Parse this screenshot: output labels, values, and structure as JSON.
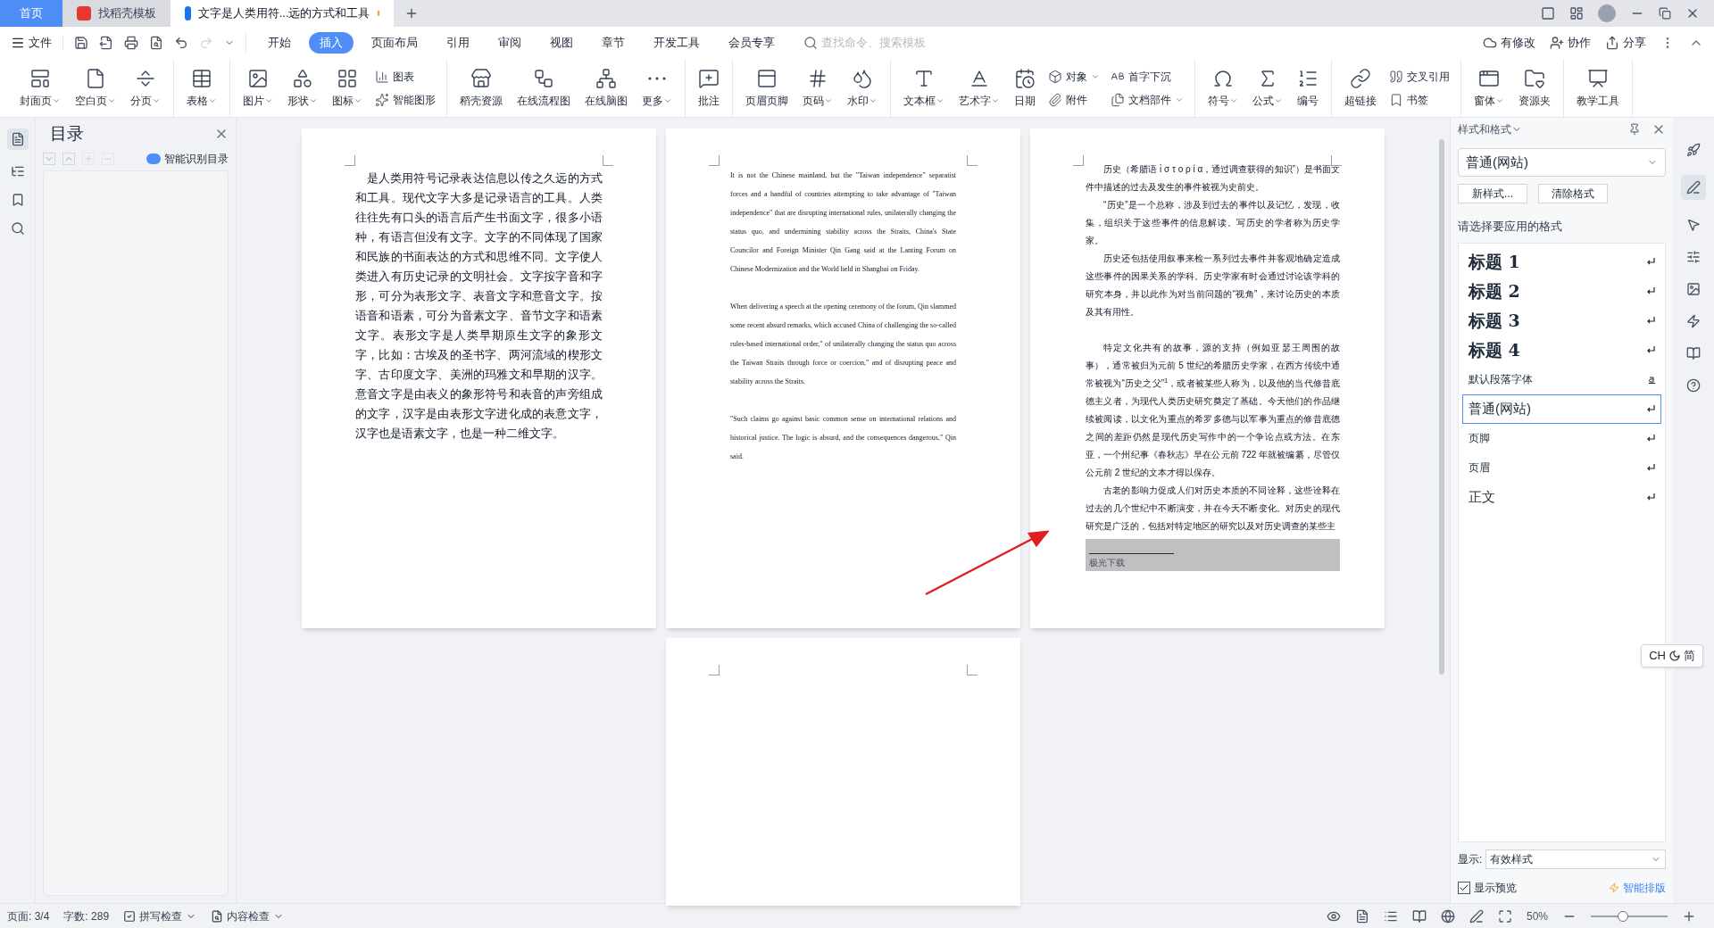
{
  "tabs": [
    {
      "label": "首页",
      "kind": "home",
      "selected": false
    },
    {
      "label": "找稻壳模板",
      "kind": "template",
      "selected": false
    },
    {
      "label": "文字是人类用符...远的方式和工具",
      "kind": "doc",
      "selected": true,
      "modified": true
    }
  ],
  "menu": {
    "file": "文件",
    "tabs": [
      {
        "label": "开始",
        "selected": false
      },
      {
        "label": "插入",
        "selected": true
      },
      {
        "label": "页面布局",
        "selected": false
      },
      {
        "label": "引用",
        "selected": false
      },
      {
        "label": "审阅",
        "selected": false
      },
      {
        "label": "视图",
        "selected": false
      },
      {
        "label": "章节",
        "selected": false
      },
      {
        "label": "开发工具",
        "selected": false
      },
      {
        "label": "会员专享",
        "selected": false
      }
    ],
    "search_placeholder": "查找命令、搜索模板",
    "actions": [
      "有修改",
      "协作",
      "分享"
    ]
  },
  "ribbon": [
    {
      "items": [
        {
          "kind": "large",
          "label": "封面页",
          "caret": true
        },
        {
          "kind": "large",
          "label": "空白页",
          "caret": true
        },
        {
          "kind": "large",
          "label": "分页",
          "caret": true
        }
      ]
    },
    {
      "items": [
        {
          "kind": "large",
          "label": "表格",
          "caret": true
        }
      ]
    },
    {
      "items": [
        {
          "kind": "large",
          "label": "图片",
          "caret": true
        },
        {
          "kind": "large",
          "label": "形状",
          "caret": true
        },
        {
          "kind": "large",
          "label": "图标",
          "caret": true
        },
        {
          "kind": "stack",
          "items": [
            {
              "label": "图表",
              "caret": false
            },
            {
              "label": "智能图形",
              "caret": false
            }
          ]
        }
      ]
    },
    {
      "items": [
        {
          "kind": "large",
          "label": "稻壳资源",
          "caret": false
        },
        {
          "kind": "large",
          "label": "在线流程图",
          "caret": false
        },
        {
          "kind": "large",
          "label": "在线脑图",
          "caret": false
        },
        {
          "kind": "large",
          "label": "更多",
          "caret": true
        }
      ]
    },
    {
      "items": [
        {
          "kind": "large",
          "label": "批注",
          "caret": false
        }
      ]
    },
    {
      "items": [
        {
          "kind": "large",
          "label": "页眉页脚",
          "caret": false
        },
        {
          "kind": "large",
          "label": "页码",
          "caret": true
        },
        {
          "kind": "large",
          "label": "水印",
          "caret": true
        }
      ]
    },
    {
      "items": [
        {
          "kind": "large",
          "label": "文本框",
          "caret": true
        },
        {
          "kind": "large",
          "label": "艺术字",
          "caret": true
        },
        {
          "kind": "large",
          "label": "日期",
          "caret": false
        },
        {
          "kind": "stack",
          "items": [
            {
              "label": "对象",
              "caret": true
            },
            {
              "label": "附件",
              "caret": false
            }
          ]
        },
        {
          "kind": "stack",
          "items": [
            {
              "label": "首字下沉",
              "caret": false
            },
            {
              "label": "文档部件",
              "caret": true
            }
          ]
        }
      ]
    },
    {
      "items": [
        {
          "kind": "large",
          "label": "符号",
          "caret": true
        },
        {
          "kind": "large",
          "label": "公式",
          "caret": true
        },
        {
          "kind": "large",
          "label": "编号",
          "caret": false
        }
      ]
    },
    {
      "items": [
        {
          "kind": "large",
          "label": "超链接",
          "caret": false
        },
        {
          "kind": "stack",
          "items": [
            {
              "label": "交叉引用",
              "caret": false
            },
            {
              "label": "书签",
              "caret": false
            }
          ]
        }
      ]
    },
    {
      "items": [
        {
          "kind": "large",
          "label": "窗体",
          "caret": true
        },
        {
          "kind": "large",
          "label": "资源夹",
          "caret": false
        }
      ]
    },
    {
      "items": [
        {
          "kind": "large",
          "label": "教学工具",
          "caret": false
        }
      ]
    }
  ],
  "nav": {
    "title": "目录",
    "smart": "智能识别目录"
  },
  "pages": [
    {
      "kind": "cn",
      "paragraphs": [
        "是人类用符号记录表达信息以传之久远的方式和工具。现代文字大多是记录语言的工具。人类往往先有口头的语言后产生书面文字，很多小语种，有语言但没有文字。文字的不同体现了国家和民族的书面表达的方式和思维不同。文字使人类进入有历史记录的文明社会。文字按字音和字形，可分为表形文字、表音文字和意音文字。按语音和语素，可分为音素文字、音节文字和语素文字。表形文字是人类早期原生文字的象形文字，比如：古埃及的圣书字、两河流域的楔形文字、古印度文字、美洲的玛雅文和早期的汉字。意音文字是由表义的象形符号和表音的声旁组成的文字，汉字是由表形文字进化成的表意文字，汉字也是语素文字，也是一种二维文字。"
      ]
    },
    {
      "kind": "en",
      "paragraphs": [
        "It is not the Chinese mainland, but the \"Taiwan independence\" separatist forces and a handful of countries attempting to take advantage of \"Taiwan independence\" that are disrupting international rules, unilaterally changing the status quo, and undermining stability across the Straits, China's State Councilor and Foreign Minister Qin Gang said at the Lanting Forum on Chinese Modernization and the World held in Shanghai on Friday.",
        "When delivering a speech at the opening ceremony of the forum, Qin slammed some recent absurd remarks, which accused China of challenging the so-called rules-based international order,\" of unilaterally changing the status quo across the Taiwan Straits through force or coercion,\" and of disrupting peace and stability across the Straits.",
        "\"Such claims go against basic common sense on international relations and historical justice. The logic is absurd, and the consequences dangerous,\" Qin said."
      ]
    },
    {
      "kind": "small",
      "paragraphs": [
        "历史（希腊语 ἱ σ τ ο ρ ί α，通过调查获得的知识”）是书面文件中描述的过去及发生的事件被视为史前史。",
        "“历史”是一个总称，涉及到过去的事件以及记忆，发现，收集，组织关于这些事件的信息解读。写历史的学者称为历史学家。",
        "历史还包括使用叙事来检一系列过去事件并客观地确定造成这些事件的因果关系的学科。历史学家有时会通过讨论该学科的研究本身，并以此作为对当前问题的“视角”，来讨论历史的本质及其有用性。",
        "特定文化共有的故事，源的支持（例如亚瑟王周围的故事），通常被归为元前 5 世纪的希腊历史学家，在西方传统中通常被视为“历史之父”$^{1}$，或者被某些人称为，以及他的当代修昔底德主义者，为现代人类历史研究奠定了基础。今天他们的作品继续被阅读，以文化为重点的希罗多德与以军事为重点的修昔底德之间的差距仍然是现代历史写作中的一个争论点或方法。在东亚，一个州纪事《春秋志》早在公元前 722 年就被编纂，尽管仅公元前 2 世纪的文本才得以保存。",
        "古老的影响力促成人们对历史本质的不同诠释，这些诠释在过去的几个世纪中不断演变，并在今天不断变化。对历史的现代研究是广泛的，包括对特定地区的研究以及对历史调查的某些主"
      ],
      "footnote": "极光下载"
    },
    {
      "kind": "empty"
    }
  ],
  "styles": {
    "title": "样式和格式",
    "current": "普通(网站)",
    "buttons": [
      "新样式...",
      "清除格式"
    ],
    "prompt": "请选择要应用的格式",
    "items": [
      {
        "label": "标题 1",
        "kind": "heading",
        "selected": false
      },
      {
        "label": "标题 2",
        "kind": "heading",
        "selected": false
      },
      {
        "label": "标题 3",
        "kind": "heading",
        "selected": false
      },
      {
        "label": "标题 4",
        "kind": "heading",
        "selected": false
      },
      {
        "label": "默认段落字体",
        "kind": "char",
        "selected": false
      },
      {
        "label": "普通(网站)",
        "kind": "large",
        "selected": true
      },
      {
        "label": "页脚",
        "kind": "para",
        "selected": false
      },
      {
        "label": "页眉",
        "kind": "para",
        "selected": false
      },
      {
        "label": "正文",
        "kind": "large",
        "selected": false
      }
    ],
    "show_label": "显示:",
    "show_value": "有效样式",
    "preview": {
      "label": "显示预览",
      "checked": true
    },
    "smart": "智能排版"
  },
  "ime": {
    "lang": "CH",
    "mode": "简"
  },
  "status": {
    "page": "页面: 3/4",
    "words": "字数: 289",
    "spell": "拼写检查",
    "content": "内容检查",
    "zoom": "50%",
    "zoom_slider": {
      "level": 0.4
    }
  }
}
